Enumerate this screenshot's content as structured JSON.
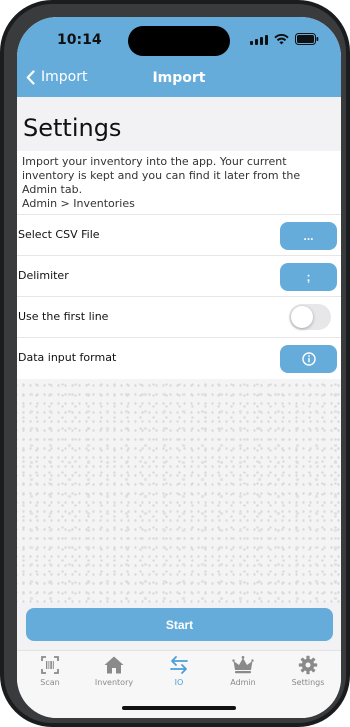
{
  "status": {
    "time": "10:14"
  },
  "nav": {
    "back_label": "Import",
    "title": "Import"
  },
  "settings": {
    "title": "Settings",
    "description": "Import your inventory into the app. Your current inventory is kept and you can find it later from the Admin tab.",
    "path": "Admin > Inventories"
  },
  "rows": [
    {
      "label": "Select CSV File",
      "button": "..."
    },
    {
      "label": "Delimiter",
      "button": ";"
    },
    {
      "label": "Use the first line",
      "toggle_on": false
    },
    {
      "label": "Data input format",
      "button_icon": "info-icon"
    }
  ],
  "start_label": "Start",
  "tabs": [
    {
      "label": "Scan",
      "icon": "barcode-scan-icon"
    },
    {
      "label": "Inventory",
      "icon": "home-icon"
    },
    {
      "label": "IO",
      "icon": "transfer-arrows-icon",
      "active": true
    },
    {
      "label": "Admin",
      "icon": "crown-icon"
    },
    {
      "label": "Settings",
      "icon": "gear-icon"
    }
  ],
  "colors": {
    "accent": "#66acdb",
    "active_tab": "#4b9fd6",
    "inactive_tab": "#8a8a8a"
  }
}
